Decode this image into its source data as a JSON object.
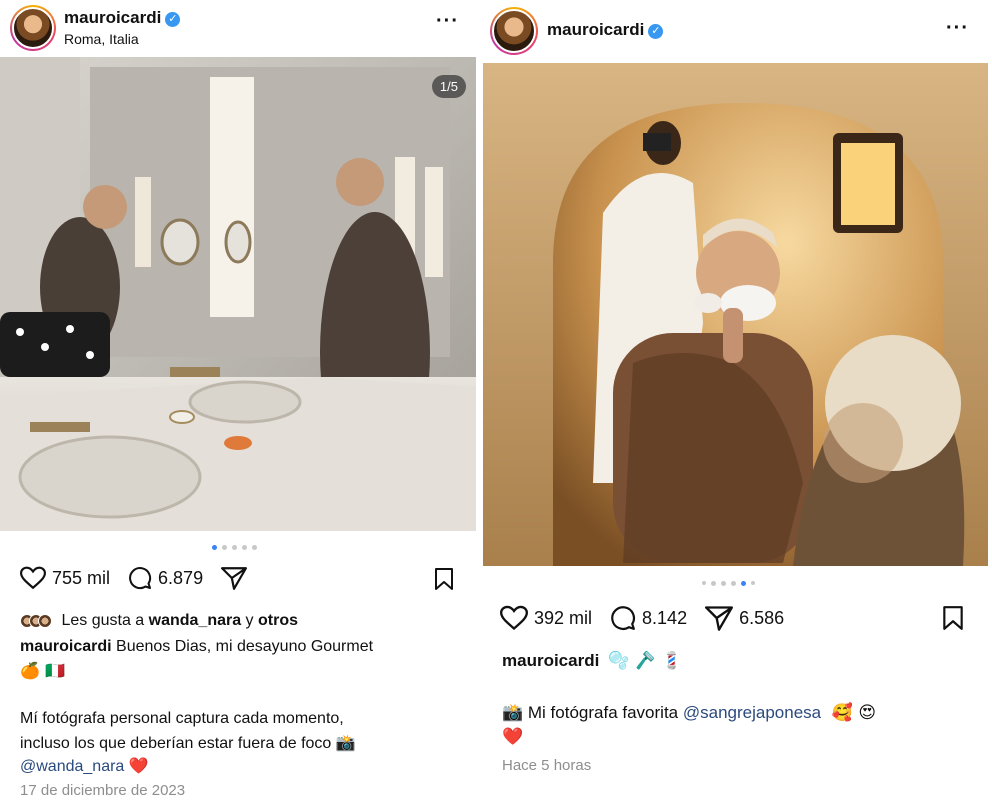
{
  "left_post": {
    "username": "mauroicardi",
    "location": "Roma, Italia",
    "more_icon": "more-horizontal-icon",
    "image_counter": "1/5",
    "carousel": {
      "count": 5,
      "active_index": 0
    },
    "likes": "755 mil",
    "comments": "6.879",
    "liked_by_prefix": "Les gusta a ",
    "liked_by_user": "wanda_nara",
    "liked_by_mid": " y ",
    "liked_by_others": "otros",
    "caption_user": "mauroicardi",
    "caption_text": " Buenos Dias, mi desayuno Gourmet",
    "caption_emojis": "🍊 🇮🇹",
    "comment_line1": "Mí fotógrafa personal captura cada momento,",
    "comment_line2": "incluso los que deberían estar fuera de foco 📸",
    "comment_mention": "@wanda_nara",
    "comment_emoji": "❤️",
    "date": "17 de diciembre de 2023"
  },
  "right_post": {
    "username": "mauroicardi",
    "more_icon": "more-horizontal-icon",
    "carousel": {
      "count": 6,
      "active_index": 4
    },
    "likes": "392 mil",
    "comments": "8.142",
    "shares": "6.586",
    "caption_user": "mauroicardi",
    "caption_emojis": "🫧 🪒 💈",
    "comment_prefix": "📸 Mi fotógrafa favorita ",
    "comment_mention": "@sangrejaponesa",
    "comment_emojis": "🥰 😍",
    "comment_line2": "❤️",
    "time": "Hace 5 horas"
  },
  "colors": {
    "verified_blue": "#3897f0",
    "active_dot": "#3b82f6",
    "muted_text": "#8e8e8e"
  }
}
